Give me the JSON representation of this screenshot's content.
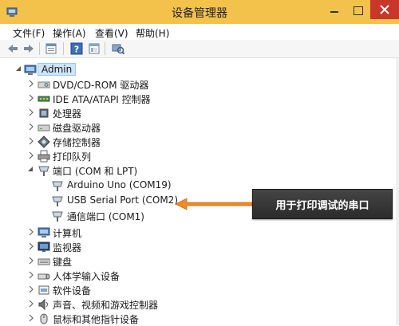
{
  "window": {
    "title": "设备管理器",
    "titlebar_color": "#f3c24a",
    "close_color": "#c7372c"
  },
  "menu": {
    "items": [
      "文件(F)",
      "操作(A)",
      "查看(V)",
      "帮助(H)"
    ]
  },
  "toolbar": {
    "buttons": [
      "back-icon",
      "forward-icon",
      "properties-icon",
      "help-icon",
      "console-tree-icon",
      "scan-hardware-icon"
    ]
  },
  "tree": {
    "root": {
      "label": "Admin",
      "icon": "computer-icon",
      "expanded": true
    },
    "items": [
      {
        "label": "DVD/CD-ROM 驱动器",
        "icon": "dvd-drive-icon",
        "expanded": false,
        "level": 1
      },
      {
        "label": "IDE ATA/ATAPI 控制器",
        "icon": "ide-controller-icon",
        "expanded": false,
        "level": 1
      },
      {
        "label": "处理器",
        "icon": "processor-icon",
        "expanded": false,
        "level": 1
      },
      {
        "label": "磁盘驱动器",
        "icon": "disk-drive-icon",
        "expanded": false,
        "level": 1
      },
      {
        "label": "存储控制器",
        "icon": "storage-controller-icon",
        "expanded": false,
        "level": 1
      },
      {
        "label": "打印队列",
        "icon": "printer-icon",
        "expanded": false,
        "level": 1
      },
      {
        "label": "端口 (COM 和 LPT)",
        "icon": "port-icon",
        "expanded": true,
        "level": 1
      },
      {
        "label": "Arduino Uno (COM19)",
        "icon": "port-device-icon",
        "level": 2
      },
      {
        "label": "USB Serial Port (COM2)",
        "icon": "port-device-icon",
        "level": 2
      },
      {
        "label": "通信端口 (COM1)",
        "icon": "port-device-icon",
        "level": 2
      },
      {
        "label": "计算机",
        "icon": "computer-icon",
        "expanded": false,
        "level": 1
      },
      {
        "label": "监视器",
        "icon": "monitor-icon",
        "expanded": false,
        "level": 1
      },
      {
        "label": "键盘",
        "icon": "keyboard-icon",
        "expanded": false,
        "level": 1
      },
      {
        "label": "人体学输入设备",
        "icon": "hid-icon",
        "expanded": false,
        "level": 1
      },
      {
        "label": "软件设备",
        "icon": "software-device-icon",
        "expanded": false,
        "level": 1
      },
      {
        "label": "声音、视频和游戏控制器",
        "icon": "sound-icon",
        "expanded": false,
        "level": 1
      },
      {
        "label": "鼠标和其他指针设备",
        "icon": "mouse-icon",
        "expanded": false,
        "level": 1
      }
    ]
  },
  "annotation": {
    "text": "用于打印调试的串口",
    "arrow_color": "#f08a24"
  }
}
